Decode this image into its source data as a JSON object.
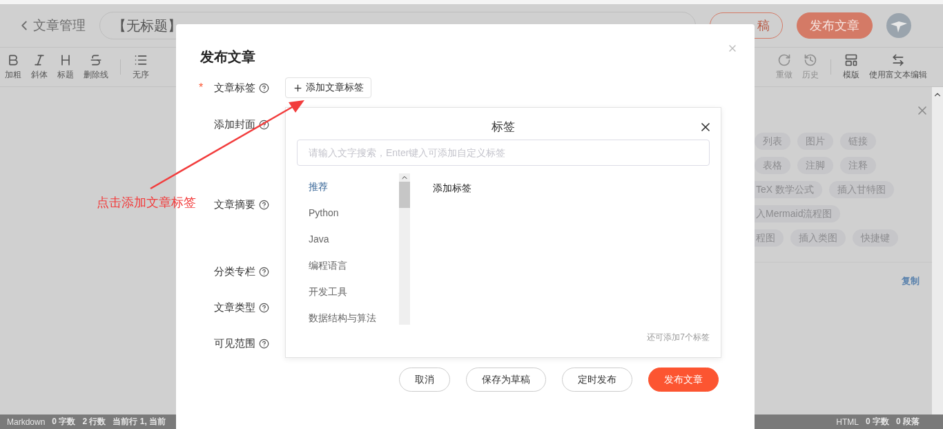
{
  "editor": {
    "back_label": "文章管理",
    "title": "【无标题】",
    "save_draft": "稿",
    "publish": "发布文章"
  },
  "toolbar": {
    "left": [
      {
        "label": "加粗",
        "kind": "bold",
        "disabled": false
      },
      {
        "label": "斜体",
        "kind": "italic",
        "disabled": false
      },
      {
        "label": "标题",
        "kind": "heading",
        "disabled": false
      },
      {
        "label": "删除线",
        "kind": "strike",
        "disabled": false
      },
      {
        "label": "无序",
        "kind": "list",
        "disabled": false
      }
    ],
    "right": [
      {
        "label": "重做",
        "kind": "redo",
        "disabled": true
      },
      {
        "label": "历史",
        "kind": "history",
        "disabled": true
      },
      {
        "label": "模版",
        "kind": "template",
        "disabled": false
      },
      {
        "label": "使用富文本编辑",
        "kind": "switch",
        "disabled": false
      }
    ]
  },
  "help_panel": {
    "chip_rows": [
      [
        {
          "label": "列表",
          "kind": "whole"
        },
        {
          "label": "图片",
          "kind": "whole"
        },
        {
          "label": "链接",
          "kind": "whole"
        }
      ],
      [
        {
          "label": "表格",
          "kind": "whole"
        },
        {
          "label": "注脚",
          "kind": "whole"
        },
        {
          "label": "注释",
          "kind": "whole"
        }
      ],
      [
        {
          "label": "TeX 数学公式",
          "kind": "cut"
        },
        {
          "label": "插入甘特图",
          "kind": "whole"
        }
      ],
      [
        {
          "label": "入Mermaid流程图",
          "kind": "cut"
        }
      ],
      [
        {
          "label": "程图",
          "kind": "cut"
        },
        {
          "label": "插入类图",
          "kind": "whole"
        },
        {
          "label": "快捷键",
          "kind": "whole"
        }
      ]
    ],
    "copy": "复制"
  },
  "status_bar": {
    "left": [
      "Markdown",
      "0 字数",
      "2 行数",
      "当前行 1, 当前"
    ],
    "right": [
      "HTML",
      "0 字数",
      "0 段落"
    ]
  },
  "dialog": {
    "title": "发布文章",
    "fields": [
      {
        "label": "文章标签",
        "kind": "tags",
        "required": true
      },
      {
        "label": "添加封面",
        "kind": "cover",
        "required": false
      },
      {
        "label": "文章摘要",
        "kind": "summary",
        "required": false
      },
      {
        "label": "分类专栏",
        "kind": "column",
        "required": false
      },
      {
        "label": "文章类型",
        "kind": "type",
        "required": false
      },
      {
        "label": "可见范围",
        "kind": "visibility",
        "required": false
      }
    ],
    "required_mark": "*",
    "add_tag_button": "添加文章标签",
    "tag_popup": {
      "title": "标签",
      "search": {
        "placeholder": "请输入文字搜索，Enter键入可添加自定义标签"
      },
      "categories": [
        {
          "label": "推荐",
          "selected": true
        },
        {
          "label": "Python",
          "selected": false
        },
        {
          "label": "Java",
          "selected": false
        },
        {
          "label": "编程语言",
          "selected": false
        },
        {
          "label": "开发工具",
          "selected": false
        },
        {
          "label": "数据结构与算法",
          "selected": false
        }
      ],
      "content_title": "添加标签",
      "remaining": "还可添加7个标签"
    },
    "buttons": [
      {
        "label": "取消",
        "kind": "default"
      },
      {
        "label": "保存为草稿",
        "kind": "default"
      },
      {
        "label": "定时发布",
        "kind": "default"
      },
      {
        "label": "发布文章",
        "kind": "primary"
      }
    ]
  },
  "annotation": {
    "text": "点击添加文章标签"
  }
}
